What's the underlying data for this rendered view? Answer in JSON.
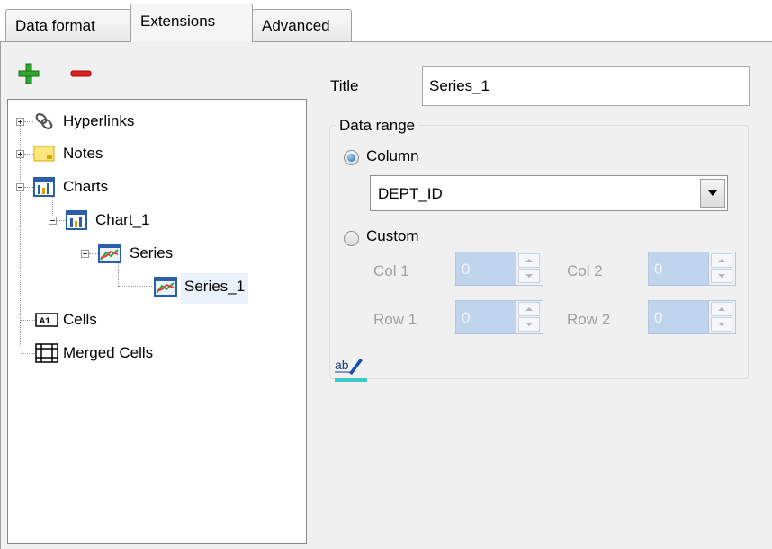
{
  "tabs": [
    {
      "label": "Data format",
      "active": false
    },
    {
      "label": "Extensions",
      "active": true
    },
    {
      "label": "Advanced",
      "active": false
    }
  ],
  "toolbar": {
    "add_icon": "plus-icon",
    "remove_icon": "minus-icon"
  },
  "tree": {
    "hyperlinks": "Hyperlinks",
    "notes": "Notes",
    "charts": "Charts",
    "chart_1": "Chart_1",
    "series": "Series",
    "series_1": "Series_1",
    "cells": "Cells",
    "merged_cells": "Merged Cells"
  },
  "form": {
    "title_label": "Title",
    "title_value": "Series_1",
    "data_range_legend": "Data range",
    "column_label": "Column",
    "column_selected": true,
    "column_value": "DEPT_ID",
    "custom_label": "Custom",
    "custom_selected": false,
    "col1_label": "Col 1",
    "col1_value": "0",
    "col2_label": "Col 2",
    "col2_value": "0",
    "row1_label": "Row 1",
    "row1_value": "0",
    "row2_label": "Row 2",
    "row2_value": "0",
    "font_button_icon": "font-format-icon"
  },
  "colors": {
    "panel_bg": "#f0f0f0",
    "selected_bg": "#eaf2fb",
    "disabled_field": "#c0d4ee"
  }
}
